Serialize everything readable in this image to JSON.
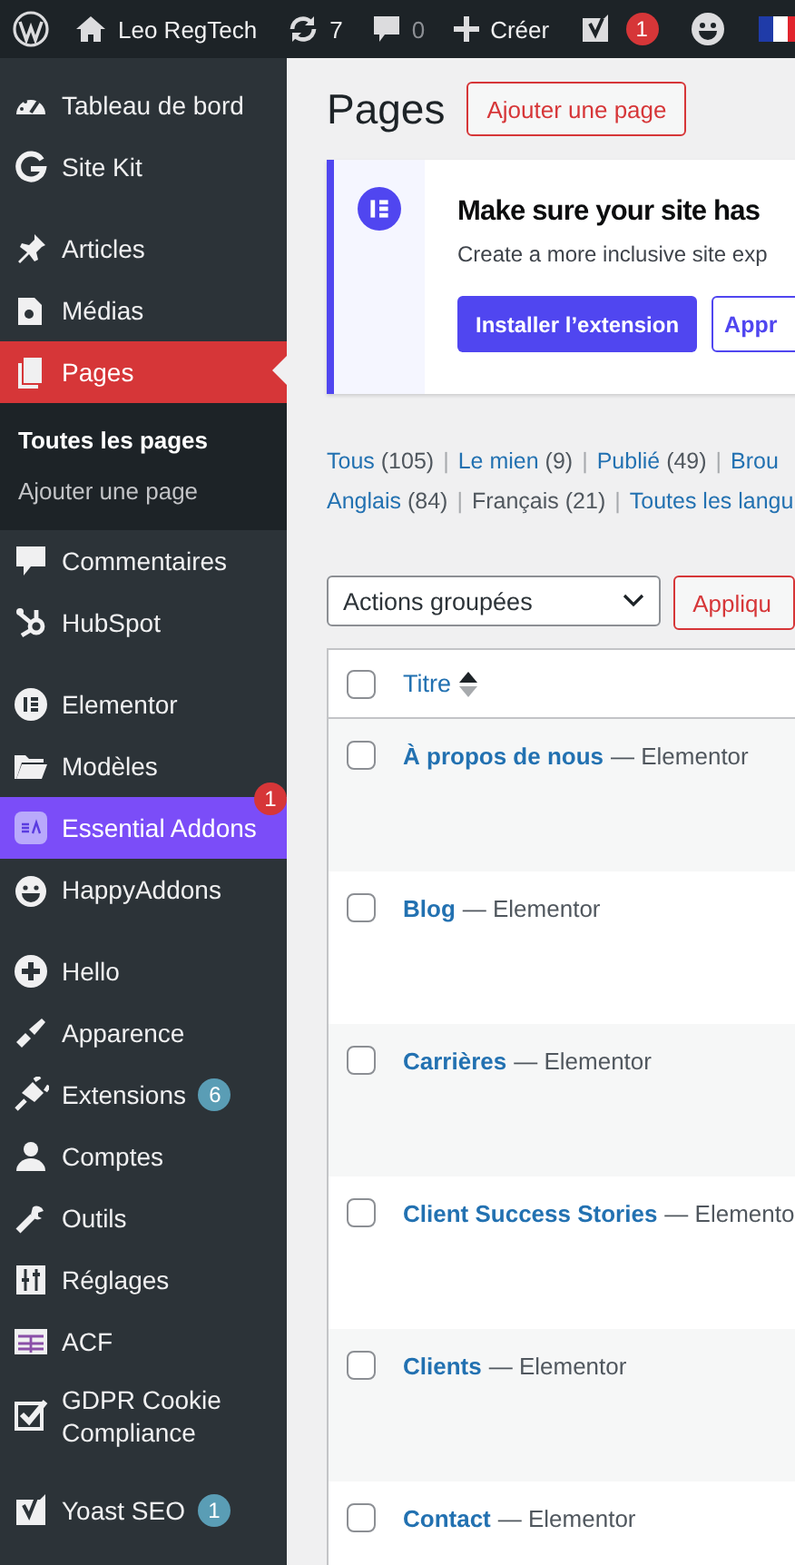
{
  "admin_bar": {
    "site_name": "Leo RegTech",
    "updates_count": "7",
    "comments_count": "0",
    "new_label": "Créer",
    "seo_badge": "1"
  },
  "sidebar": {
    "groups": [
      {
        "items": [
          {
            "label": "Tableau de bord",
            "selected": false,
            "hovered": false
          },
          {
            "label": "Site Kit",
            "selected": false,
            "hovered": false
          }
        ]
      },
      {
        "items": [
          {
            "label": "Articles",
            "selected": false,
            "hovered": false
          },
          {
            "label": "Médias",
            "selected": false,
            "hovered": false
          },
          {
            "label": "Pages",
            "selected": true,
            "hovered": false,
            "expanded": true,
            "children": [
              {
                "label": "Toutes les pages",
                "selected": true
              },
              {
                "label": "Ajouter une page",
                "selected": false
              }
            ]
          },
          {
            "label": "Commentaires",
            "selected": false,
            "hovered": false
          },
          {
            "label": "HubSpot",
            "selected": false,
            "hovered": false
          }
        ]
      },
      {
        "items": [
          {
            "label": "Elementor",
            "selected": false,
            "hovered": false
          },
          {
            "label": "Modèles",
            "selected": false,
            "hovered": false
          },
          {
            "label": "Essential Addons",
            "selected": false,
            "hovered": true,
            "badge": {
              "text": "1",
              "kind": "alert"
            }
          },
          {
            "label": "HappyAddons",
            "selected": false,
            "hovered": false
          }
        ]
      },
      {
        "items": [
          {
            "label": "Hello",
            "selected": false,
            "hovered": false
          },
          {
            "label": "Apparence",
            "selected": false,
            "hovered": false
          },
          {
            "label": "Extensions",
            "selected": false,
            "hovered": false,
            "badge": {
              "text": "6",
              "kind": "count"
            }
          },
          {
            "label": "Comptes",
            "selected": false,
            "hovered": false
          },
          {
            "label": "Outils",
            "selected": false,
            "hovered": false
          },
          {
            "label": "Réglages",
            "selected": false,
            "hovered": false
          },
          {
            "label": "ACF",
            "selected": false,
            "hovered": false
          },
          {
            "label": "GDPR Cookie Compliance",
            "selected": false,
            "hovered": false
          }
        ]
      },
      {
        "items": [
          {
            "label": "Yoast SEO",
            "selected": false,
            "hovered": false,
            "badge": {
              "text": "1",
              "kind": "count"
            }
          }
        ]
      }
    ]
  },
  "main": {
    "heading": "Pages",
    "add_button": "Ajouter une page",
    "notice": {
      "title": "Make sure your site has",
      "text": "Create a more inclusive site exp",
      "primary_button": "Installer l’extension",
      "secondary_button": "Appr"
    },
    "status_filters": [
      {
        "label": "Tous",
        "count": "(105)",
        "current": false
      },
      {
        "divider": "|",
        "label": "Le mien",
        "count": "(9)",
        "current": false
      },
      {
        "divider": "|",
        "label": "Publié",
        "count": "(49)",
        "current": false
      },
      {
        "divider": "|",
        "label": "Brou",
        "current": false
      }
    ],
    "language_filters": [
      {
        "label": "Anglais",
        "count": "(84)",
        "current": false
      },
      {
        "divider": "|",
        "label": "Français",
        "count": "(21)",
        "current": true
      },
      {
        "divider": "|",
        "label": "Toutes les langu",
        "current": false
      }
    ],
    "bulk_actions": {
      "value": "Actions groupées",
      "apply_button": "Appliqu"
    },
    "table": {
      "columns": [
        {
          "label": "Titre",
          "checked": false
        }
      ],
      "rows": [
        {
          "title": "À propos de nous",
          "state": "— Elementor",
          "checked": false
        },
        {
          "title": "Blog",
          "state": "— Elementor",
          "checked": false
        },
        {
          "title": "Carrières",
          "state": "— Elementor",
          "checked": false
        },
        {
          "title": "Client Success Stories",
          "state": "— Elemento",
          "checked": false
        },
        {
          "title": "Clients",
          "state": "— Elementor",
          "checked": false
        },
        {
          "title": "Contact",
          "state": "— Elementor",
          "checked": false
        }
      ]
    }
  }
}
